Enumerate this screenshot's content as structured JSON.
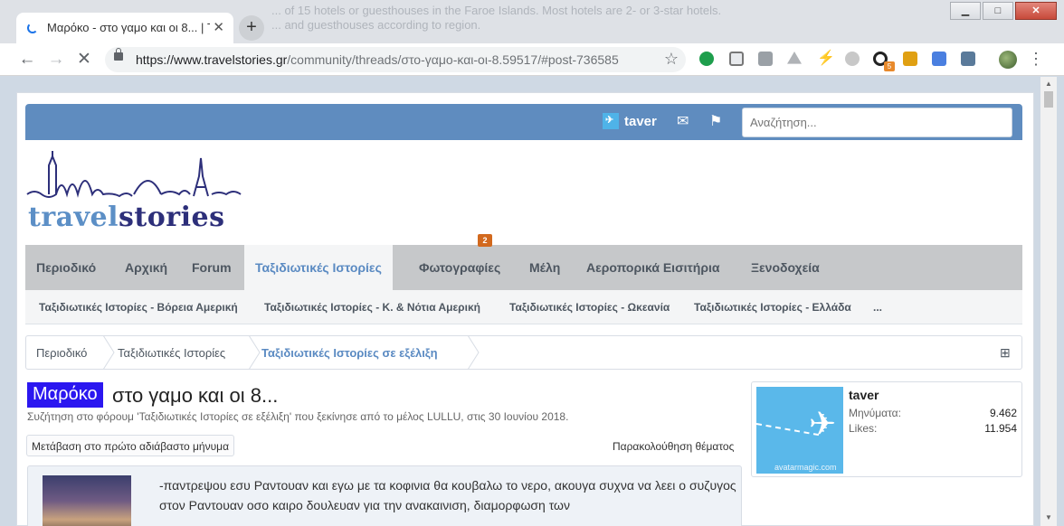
{
  "browser": {
    "background_text_line1": "... of 15 hotels or guesthouses in the Faroe Islands. Most hotels are 2- or 3-star hotels.",
    "background_text_line2": "... and guesthouses according to region.",
    "tab_title": "Μαρόκο - στο γαμο και οι 8... | T",
    "tab_close": "✕",
    "new_tab": "+",
    "win_minimize": "▁",
    "win_maximize": "□",
    "win_close": "✕",
    "url_host": "https://www.travelstories.gr",
    "url_path": "/community/threads/στο-γαμο-και-οι-8.59517/#post-736585",
    "extension_badge": "5",
    "scroll_up": "▲",
    "scroll_down": "▼"
  },
  "site": {
    "username": "taver",
    "search_placeholder": "Αναζήτηση...",
    "logo": {
      "part1": "travel",
      "part2": "stories"
    },
    "nav": [
      {
        "label": "Περιοδικό"
      },
      {
        "label": "Αρχική"
      },
      {
        "label": "Forum"
      },
      {
        "label": "Ταξιδιωτικές Ιστορίες",
        "active": true
      },
      {
        "label": "Φωτογραφίες",
        "badge": "2"
      },
      {
        "label": "Μέλη"
      },
      {
        "label": "Αεροπορικά Εισιτήρια"
      },
      {
        "label": "Ξενοδοχεία"
      }
    ],
    "subnav": [
      "Ταξιδιωτικές Ιστορίες - Βόρεια Αμερική",
      "Ταξιδιωτικές Ιστορίες - Κ. & Νότια Αμερική",
      "Ταξιδιωτικές Ιστορίες - Ωκεανία",
      "Ταξιδιωτικές Ιστορίες - Ελλάδα",
      "..."
    ],
    "breadcrumb": [
      "Περιοδικό",
      "Ταξιδιωτικές Ιστορίες",
      "Ταξιδιωτικές Ιστορίες σε εξέλιξη"
    ]
  },
  "thread": {
    "prefix": "Μαρόκο",
    "title": "στο γαμο και οι 8...",
    "description": "Συζήτηση στο φόρουμ 'Ταξιδιωτικές Ιστορίες σε εξέλιξη' που ξεκίνησε από το μέλος LULLU, στις 30 Ιουνίου 2018.",
    "first_unread": "Μετάβαση στο πρώτο αδιάβαστο μήνυμα",
    "watch": "Παρακολούθηση θέματος",
    "post_text": "-παντρεψου εσυ Ραντουαν και εγω με τα κοφινια θα κουβαλω το νερο, ακουγα συχνα να λεει ο συζυγος στον Ραντουαν οσο καιρο δουλευαν για την ανακαινιση, διαμορφωση των"
  },
  "userbox": {
    "name": "taver",
    "avatar_watermark": "avatarmagic.com",
    "messages_label": "Μηνύματα:",
    "messages_value": "9.462",
    "likes_label": "Likes:",
    "likes_value": "11.954"
  },
  "colors": {
    "topbar": "#5f8cbf",
    "nav_bg": "#c6c8ca",
    "accent": "#5a8ac2",
    "prefix_bg": "#2b17f0",
    "badge": "#d2691e"
  }
}
